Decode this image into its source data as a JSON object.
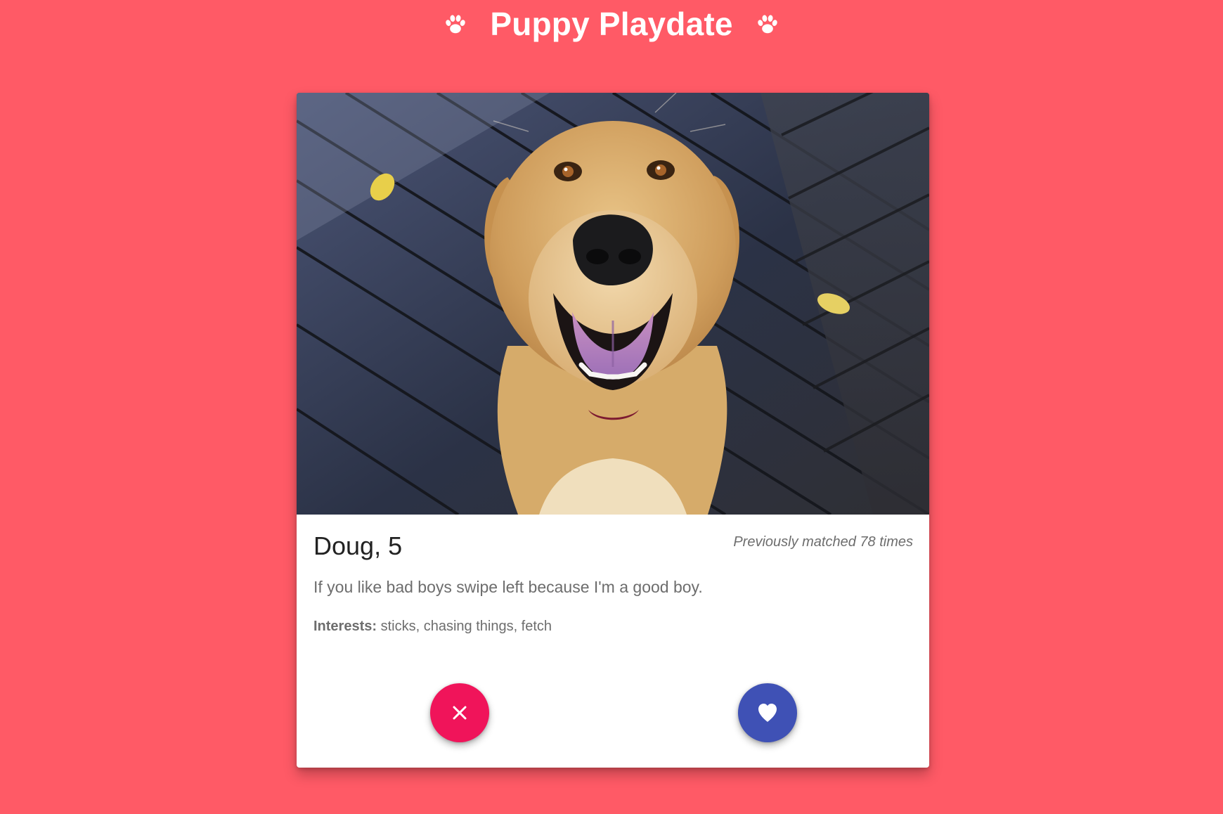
{
  "header": {
    "title": "Puppy Playdate",
    "left_icon": "paw-icon",
    "right_icon": "paw-icon"
  },
  "profile": {
    "name_age": "Doug, 5",
    "match_count": "Previously matched 78 times",
    "bio": "If you like bad boys swipe left because I'm a good boy.",
    "interests_label": "Interests:",
    "interests_value": " sticks, chasing things, fetch",
    "photo_subject": "dog"
  },
  "actions": {
    "nope_icon": "close-icon",
    "like_icon": "heart-icon"
  },
  "colors": {
    "background": "#ff5a66",
    "nope_button": "#f0145a",
    "like_button": "#3f51b5"
  }
}
